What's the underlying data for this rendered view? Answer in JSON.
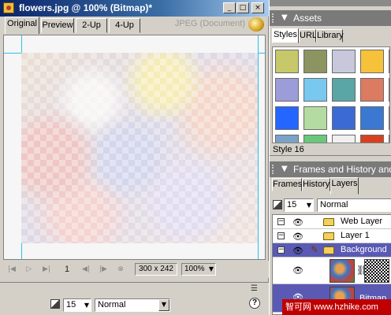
{
  "document": {
    "title": "flowers.jpg @ 100% (Bitmap)*",
    "tabs": [
      {
        "label": "Original",
        "active": true
      },
      {
        "label": "Preview",
        "active": false
      },
      {
        "label": "2-Up",
        "active": false
      },
      {
        "label": "4-Up",
        "active": false
      }
    ],
    "format_label": "JPEG (Document)",
    "frame_number": "1",
    "image_size": "300 x 242",
    "zoom": "100%"
  },
  "window_buttons": {
    "minimize": "_",
    "maximize": "□",
    "close": "×"
  },
  "property_bar": {
    "opacity": "15",
    "blend_mode": "Normal",
    "help_label": "?"
  },
  "assets_panel": {
    "title": "Assets",
    "tabs": [
      "Styles",
      "URL",
      "Library"
    ],
    "active_tab": "Styles",
    "selected_style": "Style 16",
    "swatch_colors": [
      "#c6c86a",
      "#8c9462",
      "#c8c8dc",
      "#f6c23a",
      "#eec860",
      "#9c9cd8",
      "#78c8f0",
      "#5aa6a6",
      "#dc7a62",
      "#46b45e",
      "#2466ff",
      "#b4dca0",
      "#3c6ad4",
      "#3a78d2",
      "#b28a8a",
      "#7aa2c8",
      "#6ac87a",
      "#f0f0f0",
      "#d84020",
      "#e06a40"
    ]
  },
  "frames_panel": {
    "title": "Frames and History and La",
    "tabs": [
      "Frames",
      "History",
      "Layers"
    ],
    "active_tab": "Layers",
    "opacity": "15",
    "blend_mode": "Normal",
    "layers": [
      {
        "name": "Web Layer",
        "selected": false
      },
      {
        "name": "Layer 1",
        "selected": false
      },
      {
        "name": "Background",
        "selected": true
      },
      {
        "name": "Bitmap",
        "selected": false
      }
    ]
  },
  "watermark_text": "智可网 www.hzhike.com"
}
